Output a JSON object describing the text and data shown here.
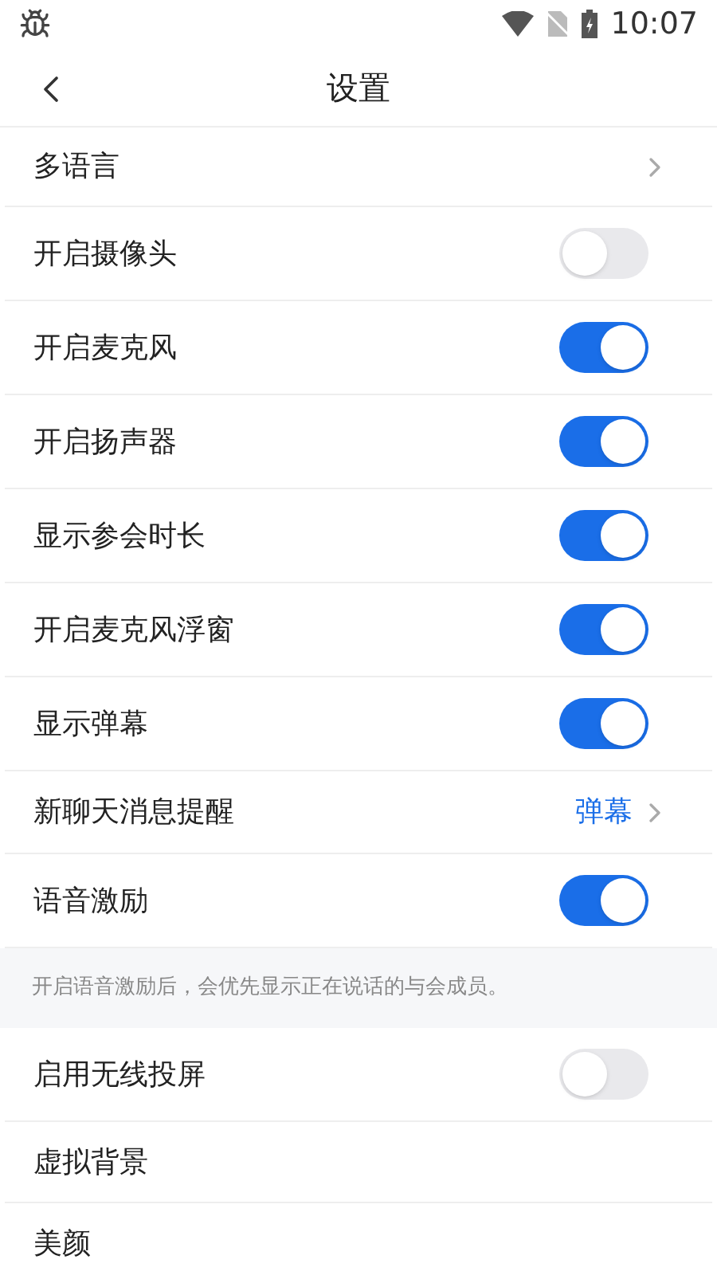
{
  "status_bar": {
    "time": "10:07"
  },
  "header": {
    "title": "设置"
  },
  "items": [
    {
      "kind": "link",
      "label": "多语言"
    },
    {
      "kind": "toggle",
      "label": "开启摄像头",
      "on": false
    },
    {
      "kind": "toggle",
      "label": "开启麦克风",
      "on": true
    },
    {
      "kind": "toggle",
      "label": "开启扬声器",
      "on": true
    },
    {
      "kind": "toggle",
      "label": "显示参会时长",
      "on": true
    },
    {
      "kind": "toggle",
      "label": "开启麦克风浮窗",
      "on": true
    },
    {
      "kind": "toggle",
      "label": "显示弹幕",
      "on": true
    },
    {
      "kind": "link",
      "label": "新聊天消息提醒",
      "value": "弹幕"
    },
    {
      "kind": "toggle",
      "label": "语音激励",
      "on": true
    },
    {
      "kind": "note",
      "label": "开启语音激励后，会优先显示正在说话的与会成员。"
    },
    {
      "kind": "toggle",
      "label": "启用无线投屏",
      "on": false
    },
    {
      "kind": "plain",
      "label": "虚拟背景"
    },
    {
      "kind": "plain",
      "label": "美颜"
    }
  ]
}
